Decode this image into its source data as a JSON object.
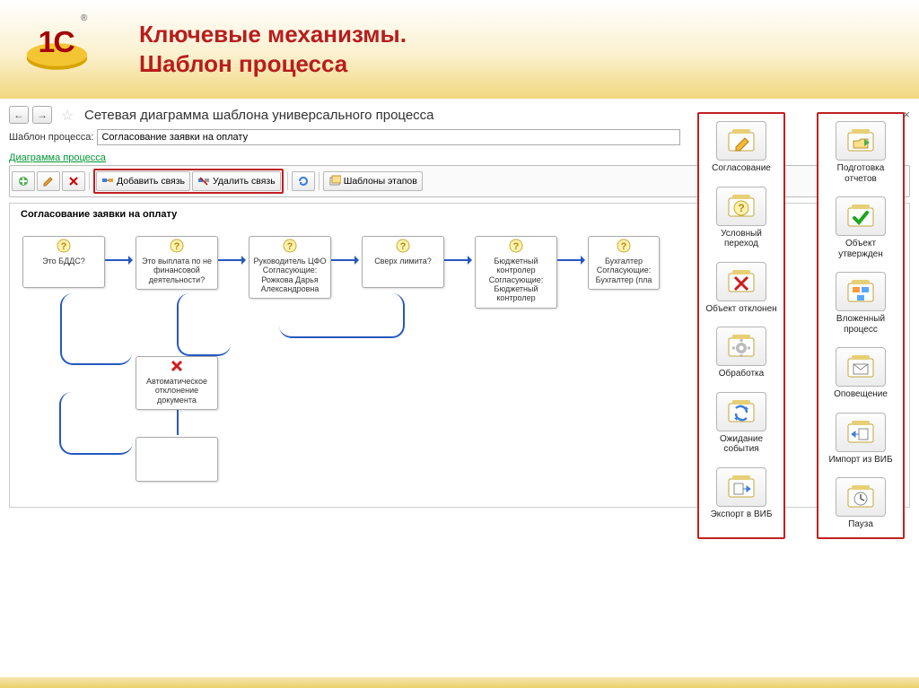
{
  "header": {
    "title_line1": "Ключевые механизмы.",
    "title_line2": "Шаблон процесса",
    "logo_name": "1C"
  },
  "nav": {
    "back": "←",
    "forward": "→",
    "star_name": "star-icon",
    "title": "Сетевая диаграмма шаблона универсального процесса",
    "close": "×"
  },
  "template_field": {
    "label": "Шаблон процесса:",
    "value": "Согласование заявки на оплату"
  },
  "tab_label": "Диаграмма процесса",
  "toolbar": {
    "add": {
      "icon": "pencil",
      "tip": "Добавить"
    },
    "edit": {
      "icon": "edit",
      "tip": "Изменить"
    },
    "delete": {
      "icon": "x",
      "tip": "Удалить"
    },
    "add_link": "Добавить связь",
    "remove_link": "Удалить связь",
    "refresh": {
      "icon": "refresh"
    },
    "stage_templates": "Шаблоны этапов"
  },
  "canvas": {
    "title": "Согласование заявки на оплату",
    "nodes": [
      {
        "id": "n1",
        "icon": "question",
        "label": "Это БДДС?"
      },
      {
        "id": "n2",
        "icon": "question",
        "label": "Это выплата по не финансовой деятельности?"
      },
      {
        "id": "n3",
        "icon": "question",
        "label": "Руководитель ЦФО Согласующие: Рожкова Дарья Александровна"
      },
      {
        "id": "n4",
        "icon": "question",
        "label": "Сверх лимита?"
      },
      {
        "id": "n5",
        "icon": "question",
        "label": "Бюджетный контролер Согласующие: Бюджетный контролер"
      },
      {
        "id": "n6",
        "icon": "question",
        "label": "Бухгалтер Согласующие: Бухгалтер (пла"
      },
      {
        "id": "n7",
        "icon": "reject",
        "label": "Автоматическое отклонение документа"
      },
      {
        "id": "n8",
        "icon": "blank",
        "label": ""
      }
    ]
  },
  "legend_left": [
    {
      "icon": "pencil",
      "label": "Согласование"
    },
    {
      "icon": "question",
      "label": "Условный переход"
    },
    {
      "icon": "reject",
      "label": "Объект отклонен"
    },
    {
      "icon": "gear",
      "label": "Обработка"
    },
    {
      "icon": "arrows",
      "label": "Ожидание события"
    },
    {
      "icon": "export",
      "label": "Экспорт в ВИБ"
    }
  ],
  "legend_right": [
    {
      "icon": "folder",
      "label": "Подготовка отчетов"
    },
    {
      "icon": "check",
      "label": "Объект утвержден"
    },
    {
      "icon": "nested",
      "label": "Вложенный процесс"
    },
    {
      "icon": "mail",
      "label": "Оповещение"
    },
    {
      "icon": "import",
      "label": "Импорт из ВИБ"
    },
    {
      "icon": "clock",
      "label": "Пауза"
    }
  ],
  "colors": {
    "accent_red": "#b81d1d",
    "link_green": "#009933",
    "arrow_blue": "#2558c0"
  }
}
